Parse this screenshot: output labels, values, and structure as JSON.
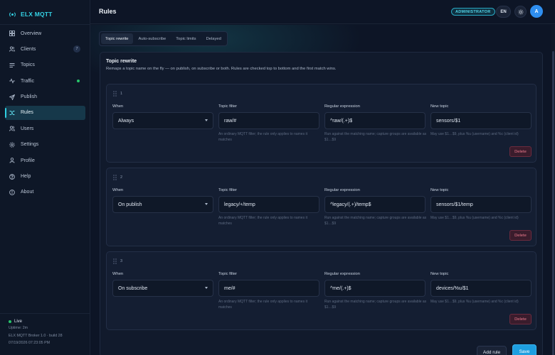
{
  "app": {
    "name": "ELX MQTT"
  },
  "sidebar": {
    "items": [
      {
        "key": "overview",
        "label": "Overview",
        "icon": "grid-icon"
      },
      {
        "key": "clients",
        "label": "Clients",
        "icon": "users-icon",
        "badge": "7"
      },
      {
        "key": "topics",
        "label": "Topics",
        "icon": "lines-icon"
      },
      {
        "key": "traffic",
        "label": "Traffic",
        "icon": "pulse-icon",
        "live": true
      },
      {
        "key": "publish",
        "label": "Publish",
        "icon": "send-icon"
      },
      {
        "key": "rules",
        "label": "Rules",
        "icon": "shuffle-icon",
        "active": true
      },
      {
        "key": "users",
        "label": "Users",
        "icon": "user-group-icon"
      },
      {
        "key": "settings",
        "label": "Settings",
        "icon": "gear-icon"
      },
      {
        "key": "profile",
        "label": "Profile",
        "icon": "person-icon"
      },
      {
        "key": "help",
        "label": "Help",
        "icon": "question-icon"
      },
      {
        "key": "about",
        "label": "About",
        "icon": "info-icon"
      }
    ],
    "footer": {
      "status": "Live",
      "uptime": "Uptime: 2m",
      "version": "ELX MQTT Broker 1.0 · build 28",
      "timestamp": "07/19/2026 07:23:05 PM"
    }
  },
  "topbar": {
    "title": "Rules",
    "role": "ADMINISTRATOR",
    "lang": "EN",
    "avatar": "A"
  },
  "tabs": [
    {
      "label": "Topic rewrite",
      "active": true
    },
    {
      "label": "Auto-subscribe"
    },
    {
      "label": "Topic limits"
    },
    {
      "label": "Delayed"
    }
  ],
  "panel": {
    "title": "Topic rewrite",
    "description": "Remaps a topic name on the fly — on publish, on subscribe or both. Rules are checked top to bottom and the first match wins.",
    "labels": {
      "when": "When",
      "filter": "Topic filter",
      "regex": "Regular expression",
      "new_topic": "New topic"
    },
    "help": {
      "filter": "An ordinary MQTT filter; the rule only applies to names it matches",
      "regex": "Run against the matching name; capture groups are available as $1…$9",
      "new_topic": "May use $1…$9, plus %u (username) and %c (client id)"
    },
    "delete_label": "Delete",
    "rules": [
      {
        "index": "1",
        "when": "Always",
        "filter": "raw/#",
        "regex": "^raw/(.+)$",
        "new_topic": "sensors/$1"
      },
      {
        "index": "2",
        "when": "On publish",
        "filter": "legacy/+/temp",
        "regex": "^legacy/(.+)/temp$",
        "new_topic": "sensors/$1/temp"
      },
      {
        "index": "3",
        "when": "On subscribe",
        "filter": "me/#",
        "regex": "^me/(.+)$",
        "new_topic": "devices/%u/$1"
      }
    ]
  },
  "actions": {
    "add_rule": "Add rule",
    "save": "Save"
  },
  "colors": {
    "accent": "#2fd0e3",
    "primary": "#1e9fe0",
    "danger": "#ee7b8e",
    "live": "#27c46a"
  }
}
